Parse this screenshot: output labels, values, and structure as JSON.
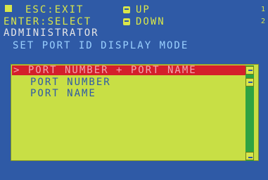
{
  "header": {
    "esc": "ESC:EXIT",
    "up": "UP",
    "enter": "ENTER:SELECT",
    "down": "DOWN",
    "right_glyph_1": "1",
    "right_glyph_2": "2"
  },
  "user": {
    "name": "ADMINISTRATOR"
  },
  "page": {
    "title": "SET PORT ID DISPLAY MODE"
  },
  "menu": {
    "selected_label": "> PORT NUMBER + PORT NAME",
    "items": [
      {
        "label": "PORT NUMBER"
      },
      {
        "label": "PORT NAME"
      }
    ]
  },
  "colors": {
    "background": "#2f5aa6",
    "accent_yellow": "#d9e64a",
    "panel": "#c8df45",
    "selected": "#d41f2b",
    "scrollbar": "#2da342"
  },
  "icons": {
    "up_key": "up-arrow-key-icon",
    "down_key": "down-arrow-key-icon",
    "scroll_up": "scroll-up-icon",
    "scroll_down": "scroll-down-icon"
  }
}
